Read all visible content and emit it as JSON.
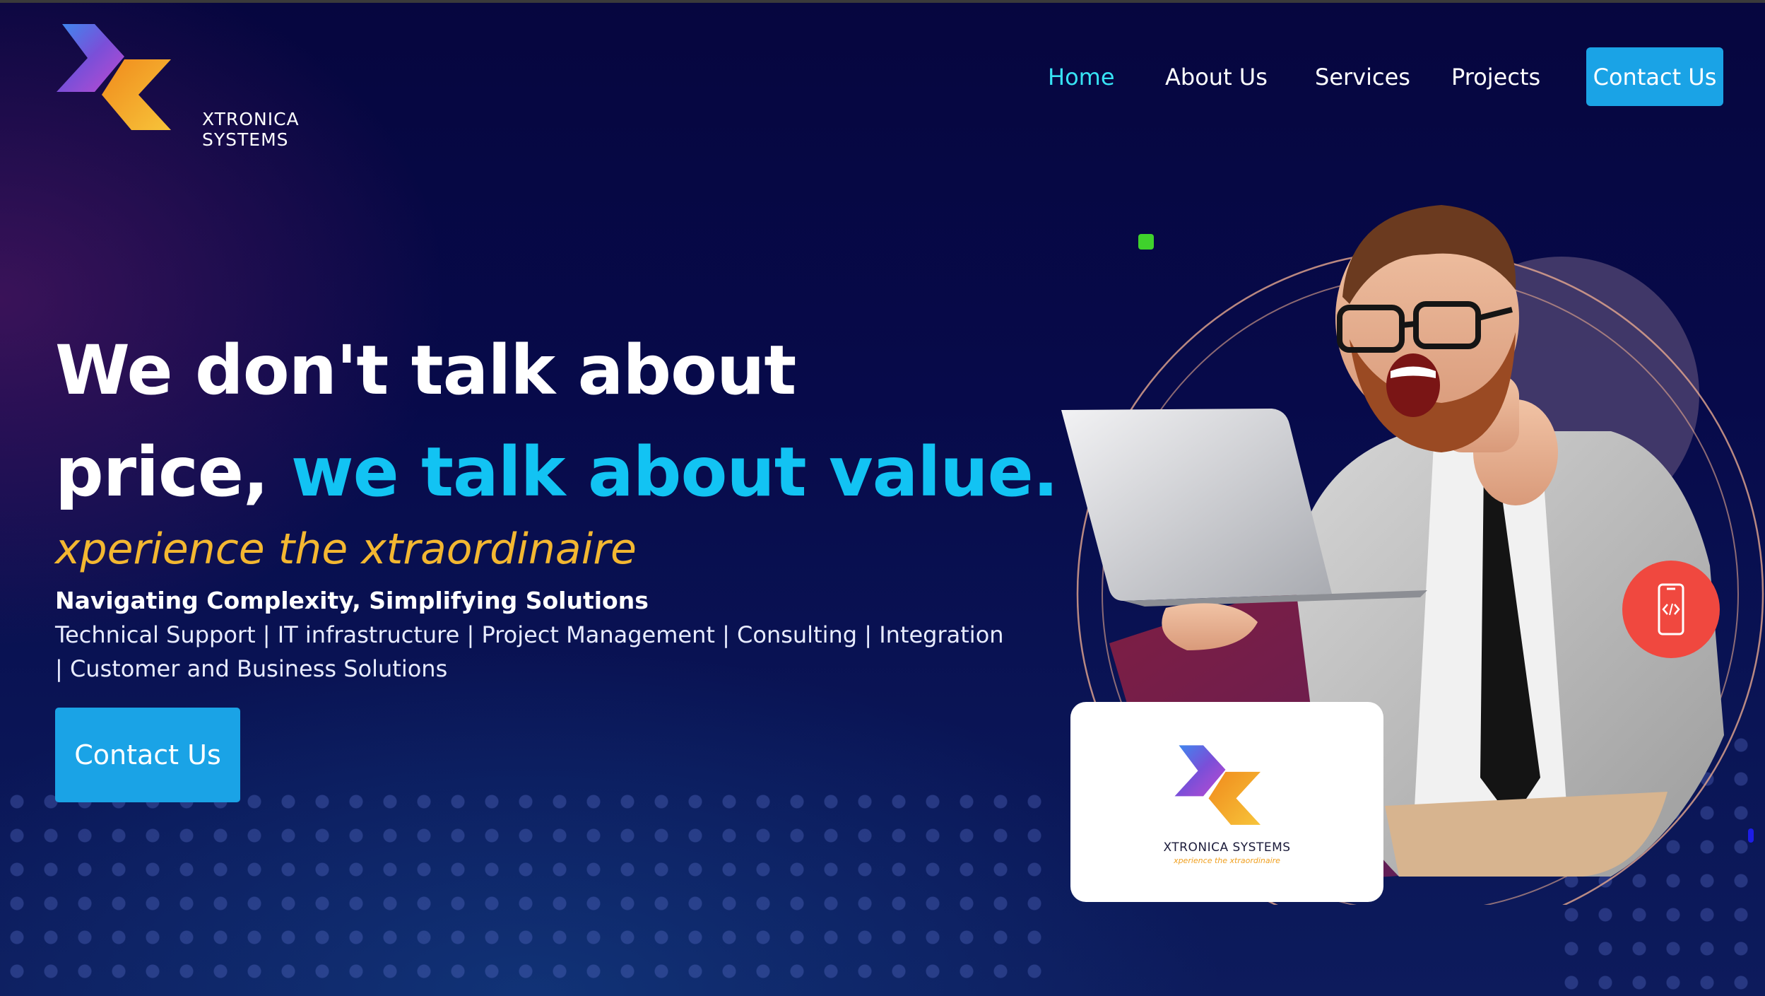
{
  "brand": {
    "name": "XTRONICA SYSTEMS",
    "tagline_small": "xperience the xtraordinaire"
  },
  "nav": {
    "items": [
      {
        "label": "Home",
        "active": true
      },
      {
        "label": "About Us",
        "active": false
      },
      {
        "label": "Services",
        "active": false
      },
      {
        "label": "Projects",
        "active": false
      }
    ],
    "cta_label": "Contact Us"
  },
  "hero": {
    "headline_line1": "We don't talk about",
    "headline_line2_plain": "price, ",
    "headline_line2_highlight": "we talk about value.",
    "tagline": "xperience the xtraordinaire",
    "subheading": "Navigating Complexity, Simplifying Solutions",
    "services": "Technical Support | IT infrastructure | Project Management | Consulting | Integration | Customer and Business Solutions",
    "cta_label": "Contact Us"
  },
  "colors": {
    "background": "#07094a",
    "accent_cyan": "#12c3f3",
    "nav_active": "#37e3f4",
    "button_blue": "#1aa3e6",
    "tagline_gold": "#f3b731",
    "badge_red": "#f0483f",
    "logo_purple": "#6f4bd8",
    "logo_orange": "#f5a623"
  },
  "icons": {
    "logo": "xtronica-chevron-logo",
    "badge": "mobile-code-icon"
  }
}
